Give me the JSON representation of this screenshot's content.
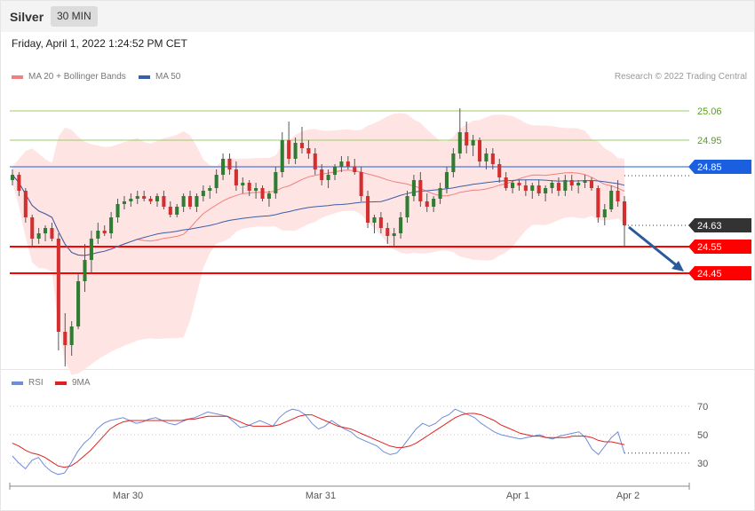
{
  "header": {
    "symbol": "Silver",
    "timeframe": "30 MIN",
    "datetime": "Friday, April 1, 2022 1:24:52 PM CET"
  },
  "legend": {
    "ma20": "MA 20 + Bollinger Bands",
    "ma50": "MA 50",
    "rsi": "RSI",
    "ma9": "9MA",
    "credit": "Research © 2022 Trading Central"
  },
  "colors": {
    "up": "#2e7d32",
    "down": "#d32f2f",
    "ma20": "#f08080",
    "ma50": "#3a5ea8",
    "band": "#ffe4e4",
    "rsi": "#6e8cd8",
    "rsi_ma": "#e02020",
    "resistance": "#9ccc65",
    "support": "#ff0000",
    "pivot": "#1a5fe0",
    "last": "#333333",
    "arrow": "#2a5a9a"
  },
  "chart_data": [
    {
      "type": "candlestick",
      "x_labels": [
        "Mar 30",
        "Mar 31",
        "Apr 1",
        "Apr 2"
      ],
      "y_range": [
        24.1,
        25.15
      ],
      "levels": [
        {
          "value": 25.06,
          "label": "25.06",
          "kind": "resistance"
        },
        {
          "value": 24.95,
          "label": "24.95",
          "kind": "resistance"
        },
        {
          "value": 24.85,
          "label": "24.85",
          "kind": "pivot"
        },
        {
          "value": 24.63,
          "label": "24.63",
          "kind": "last"
        },
        {
          "value": 24.55,
          "label": "24.55",
          "kind": "support"
        },
        {
          "value": 24.45,
          "label": "24.45",
          "kind": "support"
        }
      ],
      "forecast_arrow": {
        "from": 24.63,
        "to": 24.45,
        "direction": "down"
      },
      "series": [
        {
          "name": "MA 20 + Bollinger Bands"
        },
        {
          "name": "MA 50"
        }
      ],
      "candles": [
        [
          24.8,
          24.84,
          24.78,
          24.82
        ],
        [
          24.82,
          24.83,
          24.74,
          24.76
        ],
        [
          24.76,
          24.77,
          24.64,
          24.66
        ],
        [
          24.66,
          24.67,
          24.55,
          24.58
        ],
        [
          24.58,
          24.62,
          24.56,
          24.6
        ],
        [
          24.6,
          24.63,
          24.57,
          24.62
        ],
        [
          24.62,
          24.64,
          24.57,
          24.58
        ],
        [
          24.58,
          24.6,
          24.16,
          24.23
        ],
        [
          24.23,
          24.3,
          24.1,
          24.18
        ],
        [
          24.18,
          24.27,
          24.14,
          24.25
        ],
        [
          24.25,
          24.45,
          24.24,
          24.42
        ],
        [
          24.42,
          24.56,
          24.38,
          24.5
        ],
        [
          24.5,
          24.61,
          24.45,
          24.58
        ],
        [
          24.58,
          24.64,
          24.56,
          24.61
        ],
        [
          24.61,
          24.63,
          24.59,
          24.6
        ],
        [
          24.6,
          24.68,
          24.58,
          24.66
        ],
        [
          24.66,
          24.73,
          24.64,
          24.71
        ],
        [
          24.71,
          24.74,
          24.69,
          24.72
        ],
        [
          24.72,
          24.75,
          24.7,
          24.73
        ],
        [
          24.73,
          24.76,
          24.71,
          24.74
        ],
        [
          24.74,
          24.76,
          24.72,
          24.73
        ],
        [
          24.73,
          24.74,
          24.71,
          24.72
        ],
        [
          24.72,
          24.75,
          24.7,
          24.74
        ],
        [
          24.74,
          24.76,
          24.69,
          24.7
        ],
        [
          24.7,
          24.72,
          24.66,
          24.67
        ],
        [
          24.67,
          24.71,
          24.66,
          24.7
        ],
        [
          24.7,
          24.75,
          24.68,
          24.74
        ],
        [
          24.74,
          24.76,
          24.69,
          24.7
        ],
        [
          24.7,
          24.75,
          24.68,
          24.74
        ],
        [
          24.74,
          24.78,
          24.72,
          24.76
        ],
        [
          24.76,
          24.78,
          24.73,
          24.77
        ],
        [
          24.77,
          24.84,
          24.75,
          24.82
        ],
        [
          24.82,
          24.9,
          24.8,
          24.88
        ],
        [
          24.88,
          24.9,
          24.82,
          24.84
        ],
        [
          24.84,
          24.87,
          24.76,
          24.78
        ],
        [
          24.78,
          24.81,
          24.75,
          24.79
        ],
        [
          24.79,
          24.8,
          24.74,
          24.76
        ],
        [
          24.76,
          24.79,
          24.73,
          24.77
        ],
        [
          24.77,
          24.78,
          24.72,
          24.73
        ],
        [
          24.73,
          24.76,
          24.7,
          24.75
        ],
        [
          24.75,
          24.85,
          24.73,
          24.83
        ],
        [
          24.83,
          24.98,
          24.81,
          24.95
        ],
        [
          24.95,
          25.02,
          24.86,
          24.88
        ],
        [
          24.88,
          24.96,
          24.86,
          24.94
        ],
        [
          24.94,
          25.0,
          24.9,
          24.92
        ],
        [
          24.92,
          24.95,
          24.88,
          24.9
        ],
        [
          24.9,
          24.92,
          24.82,
          24.84
        ],
        [
          24.84,
          24.86,
          24.78,
          24.8
        ],
        [
          24.8,
          24.84,
          24.77,
          24.82
        ],
        [
          24.82,
          24.86,
          24.8,
          24.85
        ],
        [
          24.85,
          24.89,
          24.83,
          24.87
        ],
        [
          24.87,
          24.89,
          24.84,
          24.85
        ],
        [
          24.85,
          24.88,
          24.82,
          24.83
        ],
        [
          24.83,
          24.85,
          24.72,
          24.74
        ],
        [
          24.74,
          24.76,
          24.62,
          24.64
        ],
        [
          24.64,
          24.67,
          24.6,
          24.66
        ],
        [
          24.66,
          24.68,
          24.6,
          24.62
        ],
        [
          24.62,
          24.64,
          24.56,
          24.59
        ],
        [
          24.59,
          24.62,
          24.55,
          24.6
        ],
        [
          24.6,
          24.68,
          24.58,
          24.66
        ],
        [
          24.66,
          24.76,
          24.64,
          24.74
        ],
        [
          24.74,
          24.82,
          24.72,
          24.8
        ],
        [
          24.8,
          24.83,
          24.7,
          24.72
        ],
        [
          24.72,
          24.75,
          24.68,
          24.7
        ],
        [
          24.7,
          24.74,
          24.68,
          24.73
        ],
        [
          24.73,
          24.79,
          24.71,
          24.77
        ],
        [
          24.77,
          24.85,
          24.75,
          24.83
        ],
        [
          24.83,
          24.92,
          24.81,
          24.9
        ],
        [
          24.9,
          25.07,
          24.88,
          24.98
        ],
        [
          24.98,
          25.02,
          24.9,
          24.93
        ],
        [
          24.93,
          24.97,
          24.89,
          24.95
        ],
        [
          24.95,
          24.96,
          24.85,
          24.87
        ],
        [
          24.87,
          24.92,
          24.84,
          24.9
        ],
        [
          24.9,
          24.92,
          24.84,
          24.86
        ],
        [
          24.86,
          24.88,
          24.79,
          24.81
        ],
        [
          24.81,
          24.83,
          24.76,
          24.77
        ],
        [
          24.77,
          24.8,
          24.75,
          24.79
        ],
        [
          24.79,
          24.8,
          24.76,
          24.78
        ],
        [
          24.78,
          24.8,
          24.74,
          24.76
        ],
        [
          24.76,
          24.79,
          24.73,
          24.78
        ],
        [
          24.78,
          24.8,
          24.74,
          24.75
        ],
        [
          24.75,
          24.78,
          24.72,
          24.77
        ],
        [
          24.77,
          24.8,
          24.75,
          24.79
        ],
        [
          24.79,
          24.81,
          24.74,
          24.76
        ],
        [
          24.76,
          24.82,
          24.74,
          24.8
        ],
        [
          24.8,
          24.82,
          24.76,
          24.78
        ],
        [
          24.78,
          24.8,
          24.75,
          24.79
        ],
        [
          24.79,
          24.82,
          24.77,
          24.8
        ],
        [
          24.8,
          24.81,
          24.76,
          24.77
        ],
        [
          24.77,
          24.78,
          24.64,
          24.66
        ],
        [
          24.66,
          24.71,
          24.63,
          24.69
        ],
        [
          24.69,
          24.78,
          24.68,
          24.76
        ],
        [
          24.76,
          24.8,
          24.7,
          24.72
        ],
        [
          24.72,
          24.74,
          24.55,
          24.63
        ]
      ]
    },
    {
      "type": "line",
      "y_range": [
        20,
        80
      ],
      "y_ticks": [
        30,
        50,
        70
      ],
      "last_value": 37,
      "series": [
        {
          "name": "RSI",
          "values": [
            35,
            30,
            26,
            32,
            34,
            28,
            24,
            22,
            23,
            30,
            38,
            44,
            48,
            54,
            58,
            60,
            61,
            62,
            60,
            58,
            59,
            61,
            62,
            60,
            58,
            57,
            59,
            61,
            62,
            64,
            66,
            65,
            64,
            63,
            59,
            55,
            56,
            58,
            60,
            58,
            56,
            62,
            66,
            68,
            67,
            64,
            58,
            54,
            56,
            60,
            57,
            54,
            52,
            48,
            46,
            44,
            42,
            38,
            36,
            37,
            42,
            48,
            54,
            58,
            56,
            58,
            62,
            64,
            68,
            66,
            64,
            62,
            58,
            55,
            52,
            50,
            49,
            48,
            47,
            48,
            49,
            50,
            48,
            47,
            49,
            50,
            51,
            52,
            48,
            40,
            36,
            42,
            48,
            52,
            37
          ]
        },
        {
          "name": "9MA",
          "values": [
            44,
            42,
            39,
            37,
            36,
            34,
            31,
            28,
            27,
            28,
            31,
            35,
            39,
            44,
            49,
            54,
            57,
            59,
            60,
            60,
            60,
            60,
            60,
            60,
            60,
            60,
            60,
            61,
            61,
            62,
            63,
            63,
            63,
            63,
            61,
            59,
            57,
            56,
            56,
            56,
            56,
            57,
            59,
            61,
            63,
            64,
            64,
            62,
            60,
            58,
            56,
            55,
            54,
            52,
            50,
            48,
            46,
            44,
            42,
            41,
            41,
            42,
            44,
            47,
            50,
            53,
            56,
            59,
            62,
            64,
            65,
            65,
            64,
            62,
            60,
            57,
            55,
            53,
            51,
            50,
            49,
            49,
            48,
            48,
            48,
            48,
            49,
            49,
            49,
            48,
            46,
            45,
            45,
            44,
            43
          ]
        }
      ]
    }
  ],
  "x_axis": {
    "labels": [
      "Mar 30",
      "Mar 31",
      "Apr 1",
      "Apr 2"
    ]
  }
}
